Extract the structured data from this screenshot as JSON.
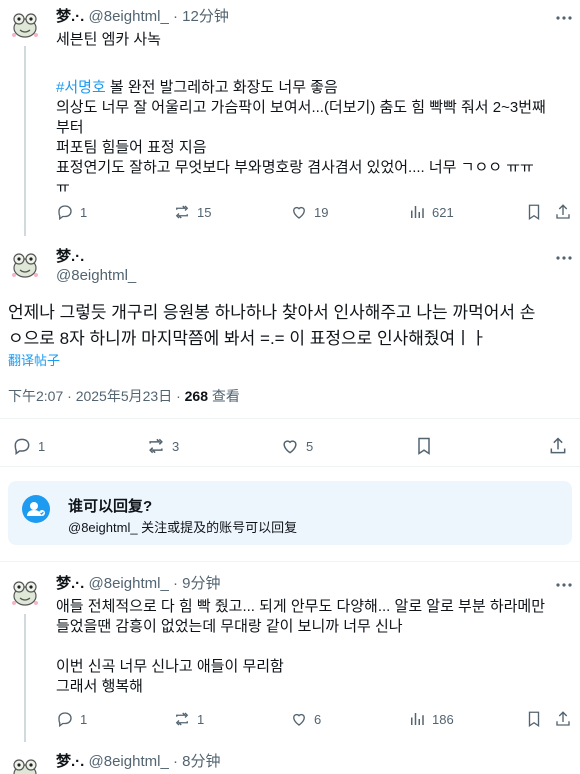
{
  "reply1": {
    "name": "梦.·.",
    "handle": "@8eightml_",
    "time": "· 12分钟",
    "lines": [
      "세븐틴 엠카 사녹",
      "",
      "#서명호",
      " 볼 완전 발그레하고 화장도 너무 좋음",
      "의상도 너무 잘 어울리고 가슴팍이 보여서...(더보기) 춤도 힘 빡빡 줘서 2~3번째",
      "부터",
      "퍼포팀 힘들어 표정 지음",
      "표정연기도 잘하고 무엇보다 부와명호랑 겸사겸서 있었어.... 너무 ㄱㅇㅇ ㅠㅠ",
      "ㅠ"
    ],
    "stats": {
      "replies": "1",
      "reposts": "15",
      "likes": "19",
      "views": "621"
    }
  },
  "main": {
    "name": "梦.·.",
    "handle": "@8eightml_",
    "text_line1": "언제나 그렇듯 개구리 응원봉 하나하나 찾아서 인사해주고 나는 까먹어서 손",
    "text_line2": "ㅇ으로 8자 하니까 마지막쯤에 봐서 =.= 이 표정으로 인사해줬여ㅣㅏ",
    "translate": "翻译帖子",
    "timestamp": "下午2:07 · 2025年5月23日 · ",
    "views_count": "268",
    "views_label": " 查看",
    "stats": {
      "replies": "1",
      "reposts": "3",
      "likes": "5"
    }
  },
  "reply_box": {
    "title": "谁可以回复?",
    "subtitle": "@8eightml_ 关注或提及的账号可以回复"
  },
  "reply2": {
    "name": "梦.·.",
    "handle": "@8eightml_",
    "time": "· 9分钟",
    "line1": "애들 전체적으로 다 힘 빡 줬고... 되게 안무도 다양해... 알로 알로 부분 하라메만",
    "line2": "들었을땐 감흥이 없었는데 무대랑 같이 보니까 너무 신나",
    "line3": "이번 신곡 너무 신나고 애들이 무리함",
    "line4": "그래서 행복해",
    "stats": {
      "replies": "1",
      "reposts": "1",
      "likes": "6",
      "views": "186"
    }
  },
  "reply3": {
    "name": "梦.·.",
    "handle": "@8eightml_",
    "time": "· 8分钟"
  },
  "colors": {
    "accent": "#1d9bf0",
    "muted": "#536471",
    "border": "#eff3f4"
  }
}
